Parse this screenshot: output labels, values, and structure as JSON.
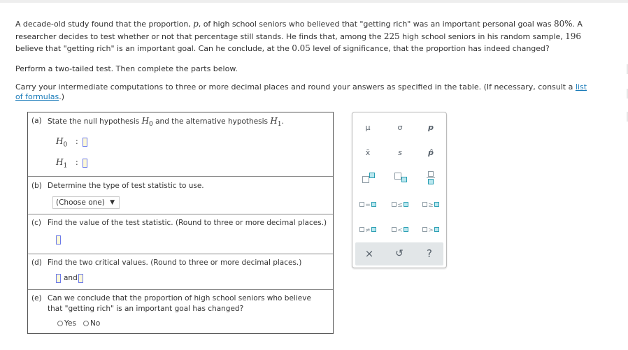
{
  "problem": {
    "line1_pre": "A decade-old study found that the proportion, ",
    "var_p": "p",
    "line1_mid": ", of high school seniors who believed that \"getting rich\" was an important personal goal was ",
    "pct": "80%",
    "line1_post": ". A researcher decides to test whether or not that percentage still stands. He finds that, among the ",
    "n": "225",
    "mid2": " high school seniors in his random sample, ",
    "x": "196",
    "mid3": " believe that \"getting rich\" is an important goal. Can he conclude, at the ",
    "alpha": "0.05",
    "end": " level of significance, that the proportion has indeed changed?"
  },
  "instructions": {
    "two_tailed": "Perform a two-tailed test. Then complete the parts below.",
    "carry_pre": "Carry your intermediate computations to three or more decimal places and round your answers as specified in the table. (If necessary, consult a ",
    "link": "list of formulas",
    "carry_post": ".)"
  },
  "parts": {
    "a": {
      "label": "(a)",
      "text_pre": "State the null hypothesis ",
      "h0": "H",
      "h0_sub": "0",
      "text_mid": " and the alternative hypothesis ",
      "h1": "H",
      "h1_sub": "1",
      "text_post": ".",
      "colon": ":"
    },
    "b": {
      "label": "(b)",
      "text": "Determine the type of test statistic to use.",
      "select_value": "(Choose one)",
      "arrow": "▼"
    },
    "c": {
      "label": "(c)",
      "text": "Find the value of the test statistic. (Round to three or more decimal places.)"
    },
    "d": {
      "label": "(d)",
      "text": "Find the two critical values. (Round to three or more decimal places.)",
      "and": "and"
    },
    "e": {
      "label": "(e)",
      "text": "Can we conclude that the proportion of high school seniors who believe that \"getting rich\" is an important goal has changed?",
      "options": [
        "Yes",
        "No"
      ]
    }
  },
  "palette": {
    "symbols": [
      "μ",
      "σ",
      "p",
      "x̄",
      "s",
      "p̂"
    ],
    "ops": [
      "=",
      "≤",
      "≥",
      "≠",
      "<",
      ">"
    ],
    "footer": {
      "clear": "×",
      "undo": "↺",
      "help": "?"
    }
  }
}
